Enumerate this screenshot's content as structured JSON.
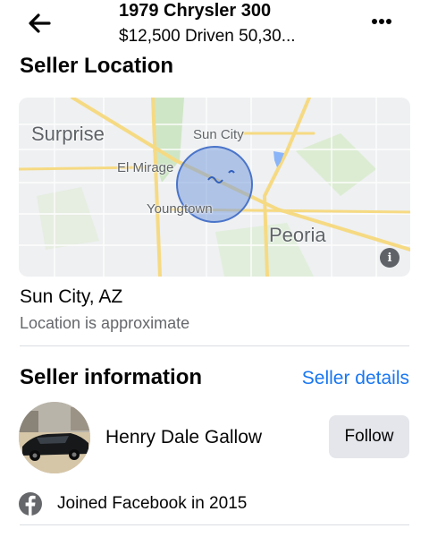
{
  "header": {
    "title": "1979 Chrysler 300",
    "subtitle": "$12,500   Driven 50,30...",
    "back_icon": "arrow-left-icon",
    "more_icon": "ellipsis-icon"
  },
  "location": {
    "section_title": "Seller Location",
    "city": "Sun City, AZ",
    "note": "Location is approximate",
    "map": {
      "labels": {
        "surprise": "Surprise",
        "sun_city": "Sun City",
        "el_mirage": "El Mirage",
        "youngtown": "Youngtown",
        "peoria": "Peoria"
      },
      "info_glyph": "i",
      "colors": {
        "road": "#f5dc8a",
        "water": "#8ab4f8",
        "park": "#cde6c2",
        "radius_fill": "#7b9fdf",
        "radius_stroke": "#4a74c9"
      }
    }
  },
  "seller": {
    "section_title": "Seller information",
    "details_link": "Seller details",
    "name": "Henry Dale Gallow",
    "follow_label": "Follow",
    "joined": "Joined Facebook in 2015",
    "joined_icon": "facebook-icon"
  },
  "colors": {
    "link": "#1877f2",
    "muted": "#65676b",
    "button_bg": "#e4e6eb"
  }
}
